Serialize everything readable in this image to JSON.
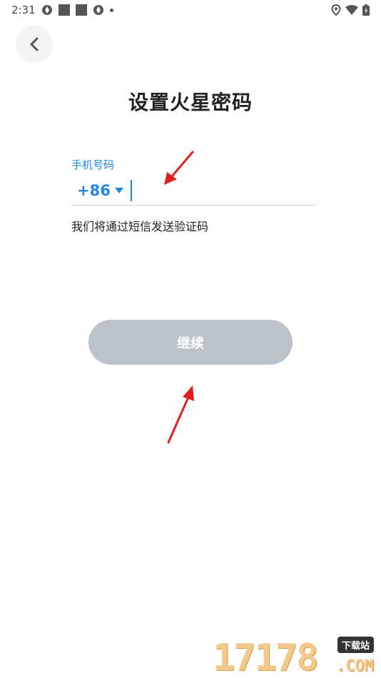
{
  "status_bar": {
    "time": "2:31"
  },
  "header": {
    "title": "设置火星密码"
  },
  "form": {
    "phone_label": "手机号码",
    "country_code": "+86",
    "sms_hint": "我们将通过短信发送验证码"
  },
  "actions": {
    "continue_label": "继续"
  },
  "watermark": {
    "digits": "17178",
    "badge": "下载站",
    "com": ".COM"
  },
  "colors": {
    "accent": "#1e88e5",
    "button_disabled": "#bcc2c9",
    "arrow": "#e02020"
  }
}
